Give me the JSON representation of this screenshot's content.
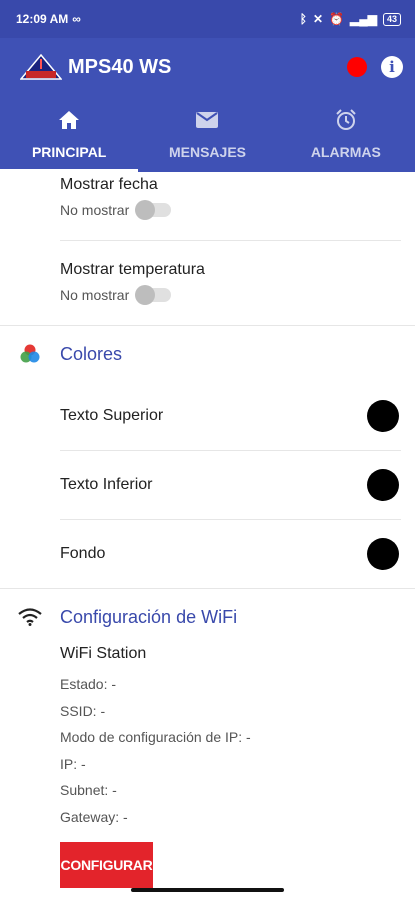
{
  "status_bar": {
    "time": "12:09 AM",
    "battery": "43"
  },
  "app": {
    "title": "MPS40 WS",
    "logo_text": "CITEP"
  },
  "tabs": [
    {
      "label": "PRINCIPAL",
      "icon": "home-icon",
      "active": true
    },
    {
      "label": "MENSAJES",
      "icon": "mail-icon",
      "active": false
    },
    {
      "label": "ALARMAS",
      "icon": "alarm-icon",
      "active": false
    }
  ],
  "display_settings": [
    {
      "title": "Mostrar fecha",
      "value": "No mostrar",
      "enabled": false
    },
    {
      "title": "Mostrar temperatura",
      "value": "No mostrar",
      "enabled": false
    }
  ],
  "colors": {
    "title": "Colores",
    "items": [
      {
        "label": "Texto Superior",
        "color": "#000000"
      },
      {
        "label": "Texto Inferior",
        "color": "#000000"
      },
      {
        "label": "Fondo",
        "color": "#000000"
      }
    ]
  },
  "wifi": {
    "title": "Configuración de WiFi",
    "mode": "WiFi Station",
    "lines": [
      "Estado: -",
      "SSID: -",
      "Modo de configuración de IP: -",
      "IP: -",
      "Subnet: -",
      "Gateway: -"
    ],
    "button_label": "CONFIGURAR"
  },
  "theme": {
    "primary": "#3f51b5",
    "accent_red": "#e3242b",
    "status_dot": "#ff0000"
  }
}
